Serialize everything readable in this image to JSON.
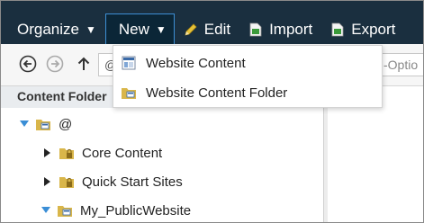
{
  "toolbar": {
    "organize_label": "Organize",
    "new_label": "New",
    "edit_label": "Edit",
    "import_label": "Import",
    "export_label": "Export"
  },
  "navbar": {
    "path_value": "@",
    "options_value": "-Optio"
  },
  "left_panel": {
    "header": "Content Folder",
    "tree": [
      {
        "label": "@",
        "expanded": true
      },
      {
        "label": "Core Content",
        "expanded": false
      },
      {
        "label": "Quick Start Sites",
        "expanded": false
      },
      {
        "label": "My_PublicWebsite",
        "expanded": true
      }
    ]
  },
  "new_menu": {
    "items": [
      {
        "label": "Website Content",
        "icon": "website-content-icon"
      },
      {
        "label": "Website Content Folder",
        "icon": "website-folder-icon"
      }
    ]
  },
  "colors": {
    "toolbar_bg": "#1a2f3f",
    "active_border": "#3d8fd4",
    "folder": "#d9b64a",
    "tree_arrow_blue": "#3a8ed6"
  }
}
